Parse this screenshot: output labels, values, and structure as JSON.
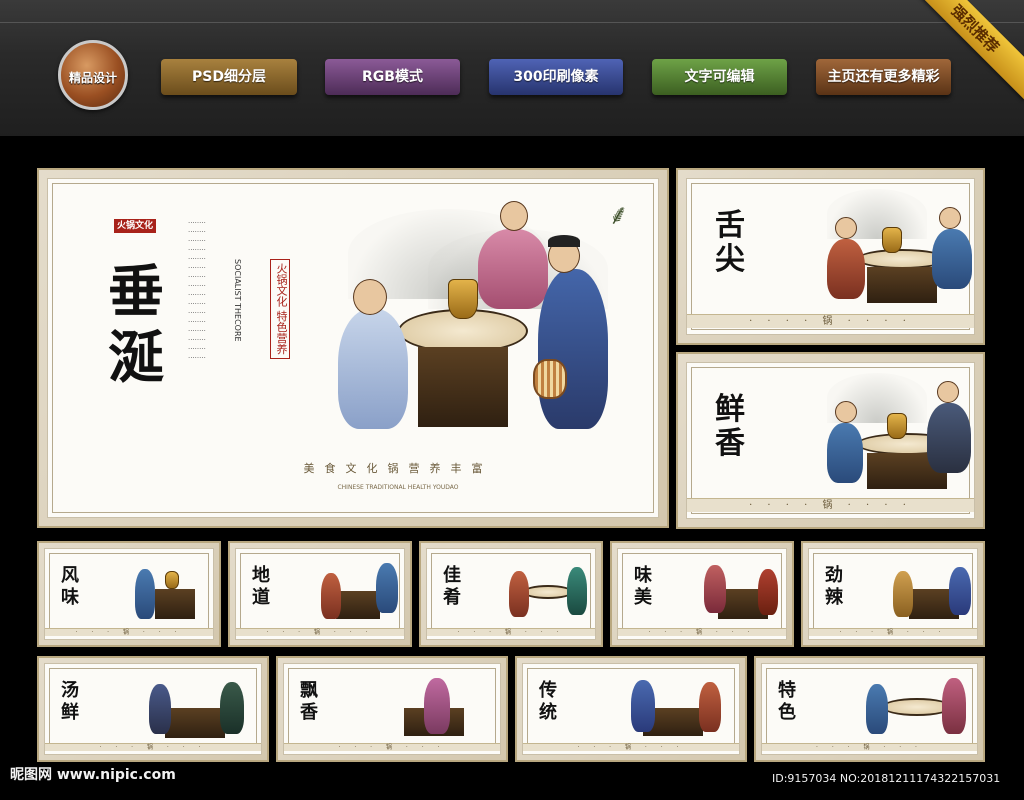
{
  "header": {
    "badge_text": "精品设计",
    "pills": [
      "PSD细分层",
      "RGB模式",
      "300印刷像素",
      "文字可编辑",
      "主页还有更多精彩"
    ],
    "corner_ribbon": "强烈推荐"
  },
  "main_poster": {
    "title": "垂涎",
    "brand_seal": "火锅文化",
    "subtitle_vertical": "火锅文化 特色营养",
    "english_vertical": "SOCIALIST THECORE",
    "footer_text": "美食文化锅营养丰富",
    "footer_center": "锅",
    "footer_english": "CHINESE TRADITIONAL HEALTH YOUDAO"
  },
  "side_posters": [
    {
      "title": "舌尖"
    },
    {
      "title": "鲜香"
    }
  ],
  "small_posters_row1": [
    {
      "title": "风味"
    },
    {
      "title": "地道"
    },
    {
      "title": "佳肴"
    },
    {
      "title": "味美"
    },
    {
      "title": "劲辣"
    }
  ],
  "small_posters_row2": [
    {
      "title": "汤鲜"
    },
    {
      "title": "飘香"
    },
    {
      "title": "传统"
    },
    {
      "title": "特色"
    }
  ],
  "watermark": {
    "site": "昵图网 www.nipic.com",
    "id": "ID:9157034 NO:20181211174322157031"
  },
  "colors": {
    "background": "#000000",
    "panel_frame": "#d3c7ad",
    "seal_red": "#a8221a"
  }
}
